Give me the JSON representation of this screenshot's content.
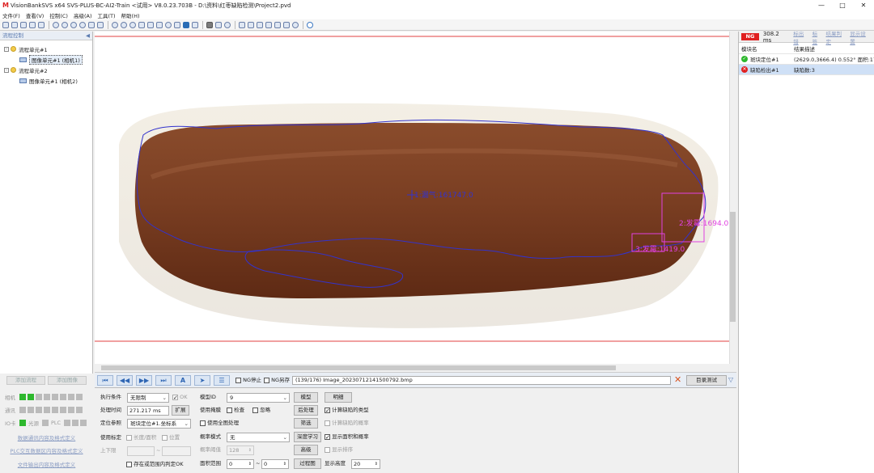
{
  "window": {
    "title": "VisionBankSVS x64 SVS-PLUS-BC-AI2-Train <试用> V8.0.23.703B - D:\\资料\\红枣缺陷检测\\Project2.pvd",
    "controls": [
      "—",
      "□",
      "✕"
    ]
  },
  "menu": [
    "文件(F)",
    "查看(V)",
    "控制(C)",
    "高级(A)",
    "工具(T)",
    "帮助(H)"
  ],
  "left_panel": {
    "header": "流程控制",
    "pin": "◀",
    "tree": [
      {
        "label": "流程单元#1",
        "child": "图像单元#1 (相机1)"
      },
      {
        "label": "流程单元#2",
        "child": "图像单元#1 (相机2)"
      }
    ],
    "buttons": {
      "add_flow": "添加流程",
      "add_image": "添加图像"
    },
    "status_rows": [
      {
        "label": "相机"
      },
      {
        "label": "通讯"
      },
      {
        "label": "IO卡",
        "extra1": "光源",
        "extra2": "PLC"
      }
    ],
    "links": [
      "数据通讯内容及格式定义",
      "PLC交互数据区内容及格式定义",
      "文件输出内容及格式定义"
    ]
  },
  "image": {
    "annotation_1": "1:漏气:161747.0",
    "annotation_2": "2:发霉:1694.0",
    "annotation_3": "3:发霉:1419.0"
  },
  "nav": {
    "ng_stop": "NG停止",
    "ng_save": "NG另存",
    "image_name": "(139/176) Image_20230712141500792.bmp",
    "dir_test": "目录测试"
  },
  "params": {
    "exec_cond_label": "执行条件",
    "exec_cond_value": "无限制",
    "ok_label": "OK",
    "proc_time_label": "处理时间",
    "proc_time_value": "271.217 ms",
    "extend_btn": "扩展",
    "locate_ref_label": "定位参照",
    "locate_ref_value": "斑块定位#1.坐标系",
    "use_calib_label": "使用标定",
    "len_area_label": "长度/面积",
    "position_label": "位置",
    "range_label": "上下限",
    "range_sep": "~",
    "in_range_label": "存在或范围内判定OK",
    "model_id_label": "模型ID",
    "model_id_value": "9",
    "model_btn": "模型",
    "detail_btn": "明细",
    "use_mask_label": "使用掩膜",
    "check_label": "检查",
    "ignore_label": "忽略",
    "post_btn": "后处理",
    "calc_type_label": "计算缺陷的类型",
    "use_global_label": "使用全图处理",
    "filter_btn": "筛选",
    "calc_prob_label": "计算缺陷的概率",
    "prob_mode_label": "概率模式",
    "prob_mode_value": "无",
    "deep_btn": "深度学习",
    "show_area_label": "显示面积和概率",
    "prob_thresh_label": "概率阈值",
    "prob_thresh_value": "128",
    "adv_btn": "高级",
    "show_order_label": "显示排序",
    "area_range_label": "面积范围",
    "area_min": "0",
    "area_sep": "~",
    "area_max": "0",
    "process_btn": "过程图",
    "disp_height_label": "显示高度",
    "disp_height_value": "20"
  },
  "right_panel": {
    "ng": "NG",
    "time": "308.2 ms",
    "links": [
      "标出错",
      "标签",
      "结果判定",
      "显示设置"
    ],
    "col_module": "模块名",
    "col_result": "结果描述",
    "rows": [
      {
        "name": "斑块定位#1",
        "status": "ok",
        "desc": "(2629.0,3666.4) 0.552° 面积:179"
      },
      {
        "name": "缺陷检出#1",
        "status": "ng",
        "desc": "缺陷数:3"
      }
    ]
  },
  "colors": {
    "ng": "#e02020",
    "ok": "#2eb82e",
    "contour": "#3333cc",
    "mold": "#e040e0"
  }
}
